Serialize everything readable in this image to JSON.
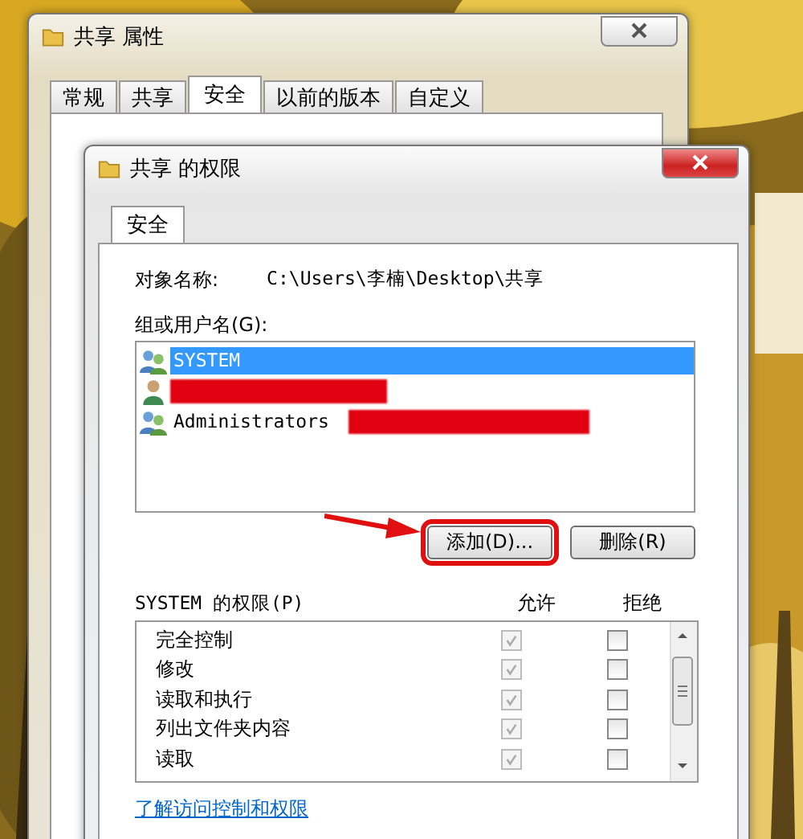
{
  "back_window": {
    "title": "共享 属性",
    "tabs": [
      {
        "label": "常规",
        "selected": false
      },
      {
        "label": "共享",
        "selected": false
      },
      {
        "label": "安全",
        "selected": true
      },
      {
        "label": "以前的版本",
        "selected": false
      },
      {
        "label": "自定义",
        "selected": false
      }
    ]
  },
  "dialog": {
    "title": "共享 的权限",
    "tab": "安全",
    "object_label": "对象名称:",
    "object_path": "C:\\Users\\李楠\\Desktop\\共享",
    "users_label": "组或用户名(G):",
    "users": [
      {
        "kind": "group",
        "name": "SYSTEM",
        "redacted": false,
        "selected": true
      },
      {
        "kind": "user",
        "redacted": true,
        "selected": false
      },
      {
        "kind": "group",
        "name": "Administrators",
        "redacted": true,
        "selected": false
      }
    ],
    "buttons": [
      {
        "label": "添加(D)...",
        "highlighted": true
      },
      {
        "label": "删除(R)",
        "highlighted": false
      }
    ],
    "permissions_label": "SYSTEM 的权限(P)",
    "columns": [
      "允许",
      "拒绝"
    ],
    "permissions": [
      {
        "name": "完全控制",
        "allow": true,
        "deny": false
      },
      {
        "name": "修改",
        "allow": true,
        "deny": false
      },
      {
        "name": "读取和执行",
        "allow": true,
        "deny": false
      },
      {
        "name": "列出文件夹内容",
        "allow": true,
        "deny": false
      },
      {
        "name": "读取",
        "allow": true,
        "deny": false
      }
    ],
    "link": "了解访问控制和权限"
  }
}
